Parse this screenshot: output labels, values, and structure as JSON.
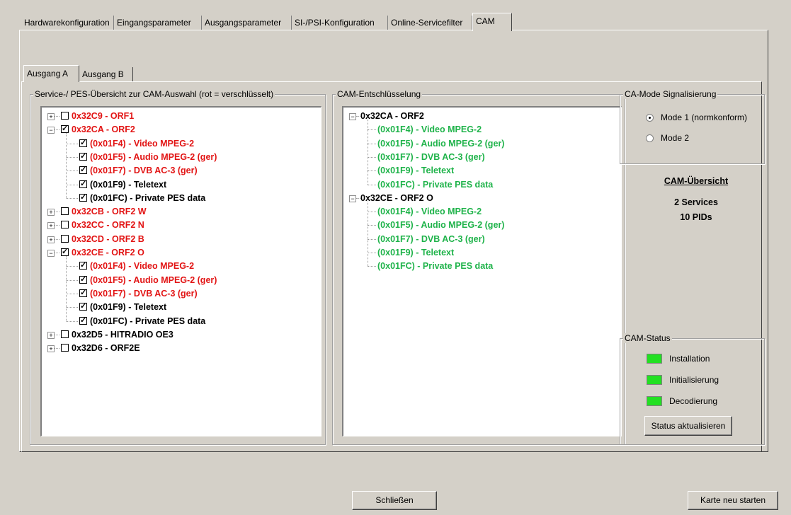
{
  "tabs": [
    "Hardwarekonfiguration",
    "Eingangsparameter",
    "Ausgangsparameter",
    "SI-/PSI-Konfiguration",
    "Online-Servicefilter",
    "CAM"
  ],
  "subtabs": [
    "Ausgang A",
    "Ausgang B"
  ],
  "service_group_title": "Service-/ PES-Übersicht zur CAM-Auswahl (rot = verschlüsselt)",
  "service_tree": [
    {
      "label": "0x32C9 - ORF1",
      "checked": false,
      "color": "red",
      "level": 0,
      "expander": "+"
    },
    {
      "label": "0x32CA - ORF2",
      "checked": true,
      "color": "red",
      "level": 0,
      "expander": "−"
    },
    {
      "label": "(0x01F4) - Video MPEG-2",
      "checked": true,
      "color": "red",
      "level": 1
    },
    {
      "label": "(0x01F5) - Audio MPEG-2 (ger)",
      "checked": true,
      "color": "red",
      "level": 1
    },
    {
      "label": "(0x01F7) - DVB AC-3 (ger)",
      "checked": true,
      "color": "red",
      "level": 1
    },
    {
      "label": "(0x01F9) - Teletext",
      "checked": true,
      "color": "black",
      "level": 1
    },
    {
      "label": "(0x01FC) - Private PES data",
      "checked": true,
      "color": "black",
      "level": 1
    },
    {
      "label": "0x32CB - ORF2 W",
      "checked": false,
      "color": "red",
      "level": 0,
      "expander": "+"
    },
    {
      "label": "0x32CC - ORF2 N",
      "checked": false,
      "color": "red",
      "level": 0,
      "expander": "+"
    },
    {
      "label": "0x32CD - ORF2 B",
      "checked": false,
      "color": "red",
      "level": 0,
      "expander": "+"
    },
    {
      "label": "0x32CE - ORF2 O",
      "checked": true,
      "color": "red",
      "level": 0,
      "expander": "−"
    },
    {
      "label": "(0x01F4) - Video MPEG-2",
      "checked": true,
      "color": "red",
      "level": 1
    },
    {
      "label": "(0x01F5) - Audio MPEG-2 (ger)",
      "checked": true,
      "color": "red",
      "level": 1
    },
    {
      "label": "(0x01F7) - DVB AC-3 (ger)",
      "checked": true,
      "color": "red",
      "level": 1
    },
    {
      "label": "(0x01F9) - Teletext",
      "checked": true,
      "color": "black",
      "level": 1
    },
    {
      "label": "(0x01FC) - Private PES data",
      "checked": true,
      "color": "black",
      "level": 1
    },
    {
      "label": "0x32D5 - HITRADIO OE3",
      "checked": false,
      "color": "black",
      "level": 0,
      "expander": "+"
    },
    {
      "label": "0x32D6 - ORF2E",
      "checked": false,
      "color": "black",
      "level": 0,
      "expander": "+"
    }
  ],
  "cam_group_title": "CAM-Entschlüsselung",
  "cam_tree": [
    {
      "label": "0x32CA - ORF2",
      "color": "black",
      "level": 0,
      "expander": "−"
    },
    {
      "label": "(0x01F4) - Video MPEG-2",
      "color": "green",
      "level": 1
    },
    {
      "label": "(0x01F5) - Audio MPEG-2 (ger)",
      "color": "green",
      "level": 1
    },
    {
      "label": "(0x01F7) - DVB AC-3 (ger)",
      "color": "green",
      "level": 1
    },
    {
      "label": "(0x01F9) - Teletext",
      "color": "green",
      "level": 1
    },
    {
      "label": "(0x01FC) - Private PES data",
      "color": "green",
      "level": 1
    },
    {
      "label": "0x32CE - ORF2 O",
      "color": "black",
      "level": 0,
      "expander": "−"
    },
    {
      "label": "(0x01F4) - Video MPEG-2",
      "color": "green",
      "level": 1
    },
    {
      "label": "(0x01F5) - Audio MPEG-2 (ger)",
      "color": "green",
      "level": 1
    },
    {
      "label": "(0x01F7) - DVB AC-3 (ger)",
      "color": "green",
      "level": 1
    },
    {
      "label": "(0x01F9) - Teletext",
      "color": "green",
      "level": 1
    },
    {
      "label": "(0x01FC) - Private PES data",
      "color": "green",
      "level": 1
    }
  ],
  "camode": {
    "title": "CA-Mode Signalisierung",
    "mode1": "Mode 1 (normkonform)",
    "mode2": "Mode 2",
    "selected": "mode1"
  },
  "overview": {
    "title": "CAM-Übersicht",
    "services": "2 Services",
    "pids": "10 PIDs"
  },
  "status": {
    "title": "CAM-Status",
    "items": [
      "Installation",
      "Initialisierung",
      "Decodierung"
    ],
    "led_color": "#22e022",
    "refresh_button": "Status aktualisieren"
  },
  "buttons": {
    "close": "Schließen",
    "restart": "Karte neu starten"
  },
  "colors": {
    "red": "#e21414",
    "green": "#1fb34a",
    "black": "#000000"
  }
}
